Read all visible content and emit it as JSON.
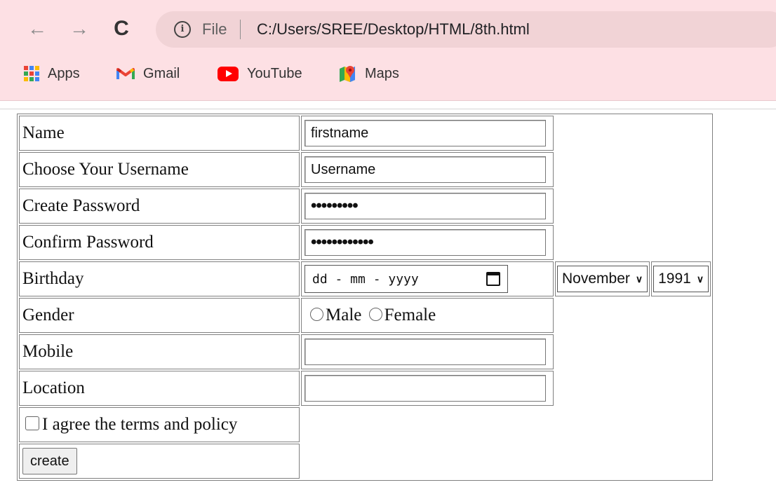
{
  "browser": {
    "nav": {
      "back_icon": "arrow-left-icon",
      "forward_icon": "arrow-right-icon",
      "reload_icon": "reload-icon"
    },
    "address": {
      "info_icon": "info-icon",
      "scheme": "File",
      "url": "C:/Users/SREE/Desktop/HTML/8th.html"
    },
    "bookmarks": [
      {
        "label": "Apps",
        "icon": "apps-grid-icon"
      },
      {
        "label": "Gmail",
        "icon": "gmail-icon"
      },
      {
        "label": "YouTube",
        "icon": "youtube-icon"
      },
      {
        "label": "Maps",
        "icon": "maps-icon"
      }
    ]
  },
  "form": {
    "name": {
      "label": "Name",
      "value": "firstname"
    },
    "username": {
      "label": "Choose Your Username",
      "value": "Username"
    },
    "password": {
      "label": "Create Password",
      "value": "•••••••••"
    },
    "confirm": {
      "label": "Confirm Password",
      "value": "••••••••••••"
    },
    "birthday": {
      "label": "Birthday",
      "date_placeholder": "dd - mm - yyyy",
      "month": "November",
      "year": "1991"
    },
    "gender": {
      "label": "Gender",
      "options": [
        "Male",
        "Female"
      ]
    },
    "mobile": {
      "label": "Mobile",
      "value": ""
    },
    "location": {
      "label": "Location",
      "value": ""
    },
    "agree": {
      "label": "I agree the terms and policy"
    },
    "submit_label": "create"
  },
  "colors": {
    "chrome_bg": "#fde0e4",
    "omnibox_bg": "#f1d3d6",
    "youtube_red": "#ff0000"
  }
}
